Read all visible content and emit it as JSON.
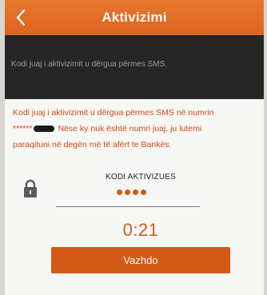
{
  "header": {
    "title": "Aktivizimi",
    "back_icon": "chevron-left-icon"
  },
  "banner": {
    "text": "Kodi juaj i aktivizimit u dërgua përmes SMS."
  },
  "info": {
    "line1": "Kodi juaj i aktivizimit u dërgua përmes SMS në numrin",
    "masked_prefix": "******",
    "line2_rest": "Nëse ky nuk është numri juaj, ju lutemi",
    "line3": "paraqituni në degën më të afërt te Bankës."
  },
  "code": {
    "label": "KODI AKTIVIZUES",
    "entered_digits": 4,
    "lock_icon": "lock-icon"
  },
  "timer": {
    "value": "0:21"
  },
  "submit": {
    "label": "Vazhdo"
  },
  "colors": {
    "accent": "#d45a17",
    "header": "#e26d27",
    "banner": "#262626"
  }
}
